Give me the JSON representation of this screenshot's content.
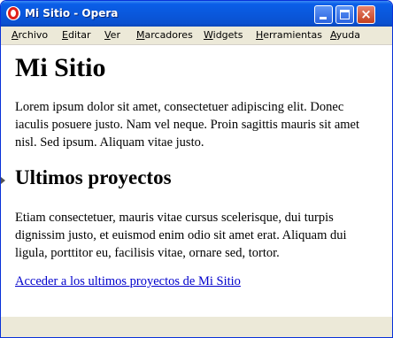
{
  "window": {
    "title": "Mi Sitio - Opera",
    "buttons": {
      "minimize": "minimize",
      "maximize": "maximize",
      "close": "×"
    }
  },
  "menubar": {
    "items": [
      {
        "label_accel": "A",
        "label_rest": "rchivo"
      },
      {
        "label_accel": "E",
        "label_rest": "ditar"
      },
      {
        "label_accel": "V",
        "label_rest": "er"
      },
      {
        "label_accel": "M",
        "label_rest": "arcadores"
      },
      {
        "label_accel": "W",
        "label_rest": "idgets"
      },
      {
        "label_accel": "H",
        "label_rest": "erramientas"
      },
      {
        "label_accel": "A",
        "label_rest": "yuda"
      }
    ]
  },
  "page": {
    "heading": "Mi Sitio",
    "intro": "Lorem ipsum dolor sit amet, consectetuer adipiscing elit. Donec iaculis posuere justo. Nam vel neque. Proin sagittis mauris sit amet nisl. Sed ipsum. Aliquam vitae justo.",
    "section_heading": "Ultimos proyectos",
    "section_text": "Etiam consectetuer, mauris vitae cursus scelerisque, dui turpis dignissim justo, et euismod enim odio sit amet erat. Aliquam dui ligula, porttitor eu, facilisis vitae, ornare sed, tortor.",
    "link_text": "Acceder a los ultimos proyectos de Mi Sitio"
  },
  "colors": {
    "titlebar": "#0a58dc",
    "link": "#0000cc",
    "chrome": "#ece9d8"
  },
  "icons": {
    "app": "opera-logo-icon",
    "section_marker": "triangle-right-icon"
  }
}
